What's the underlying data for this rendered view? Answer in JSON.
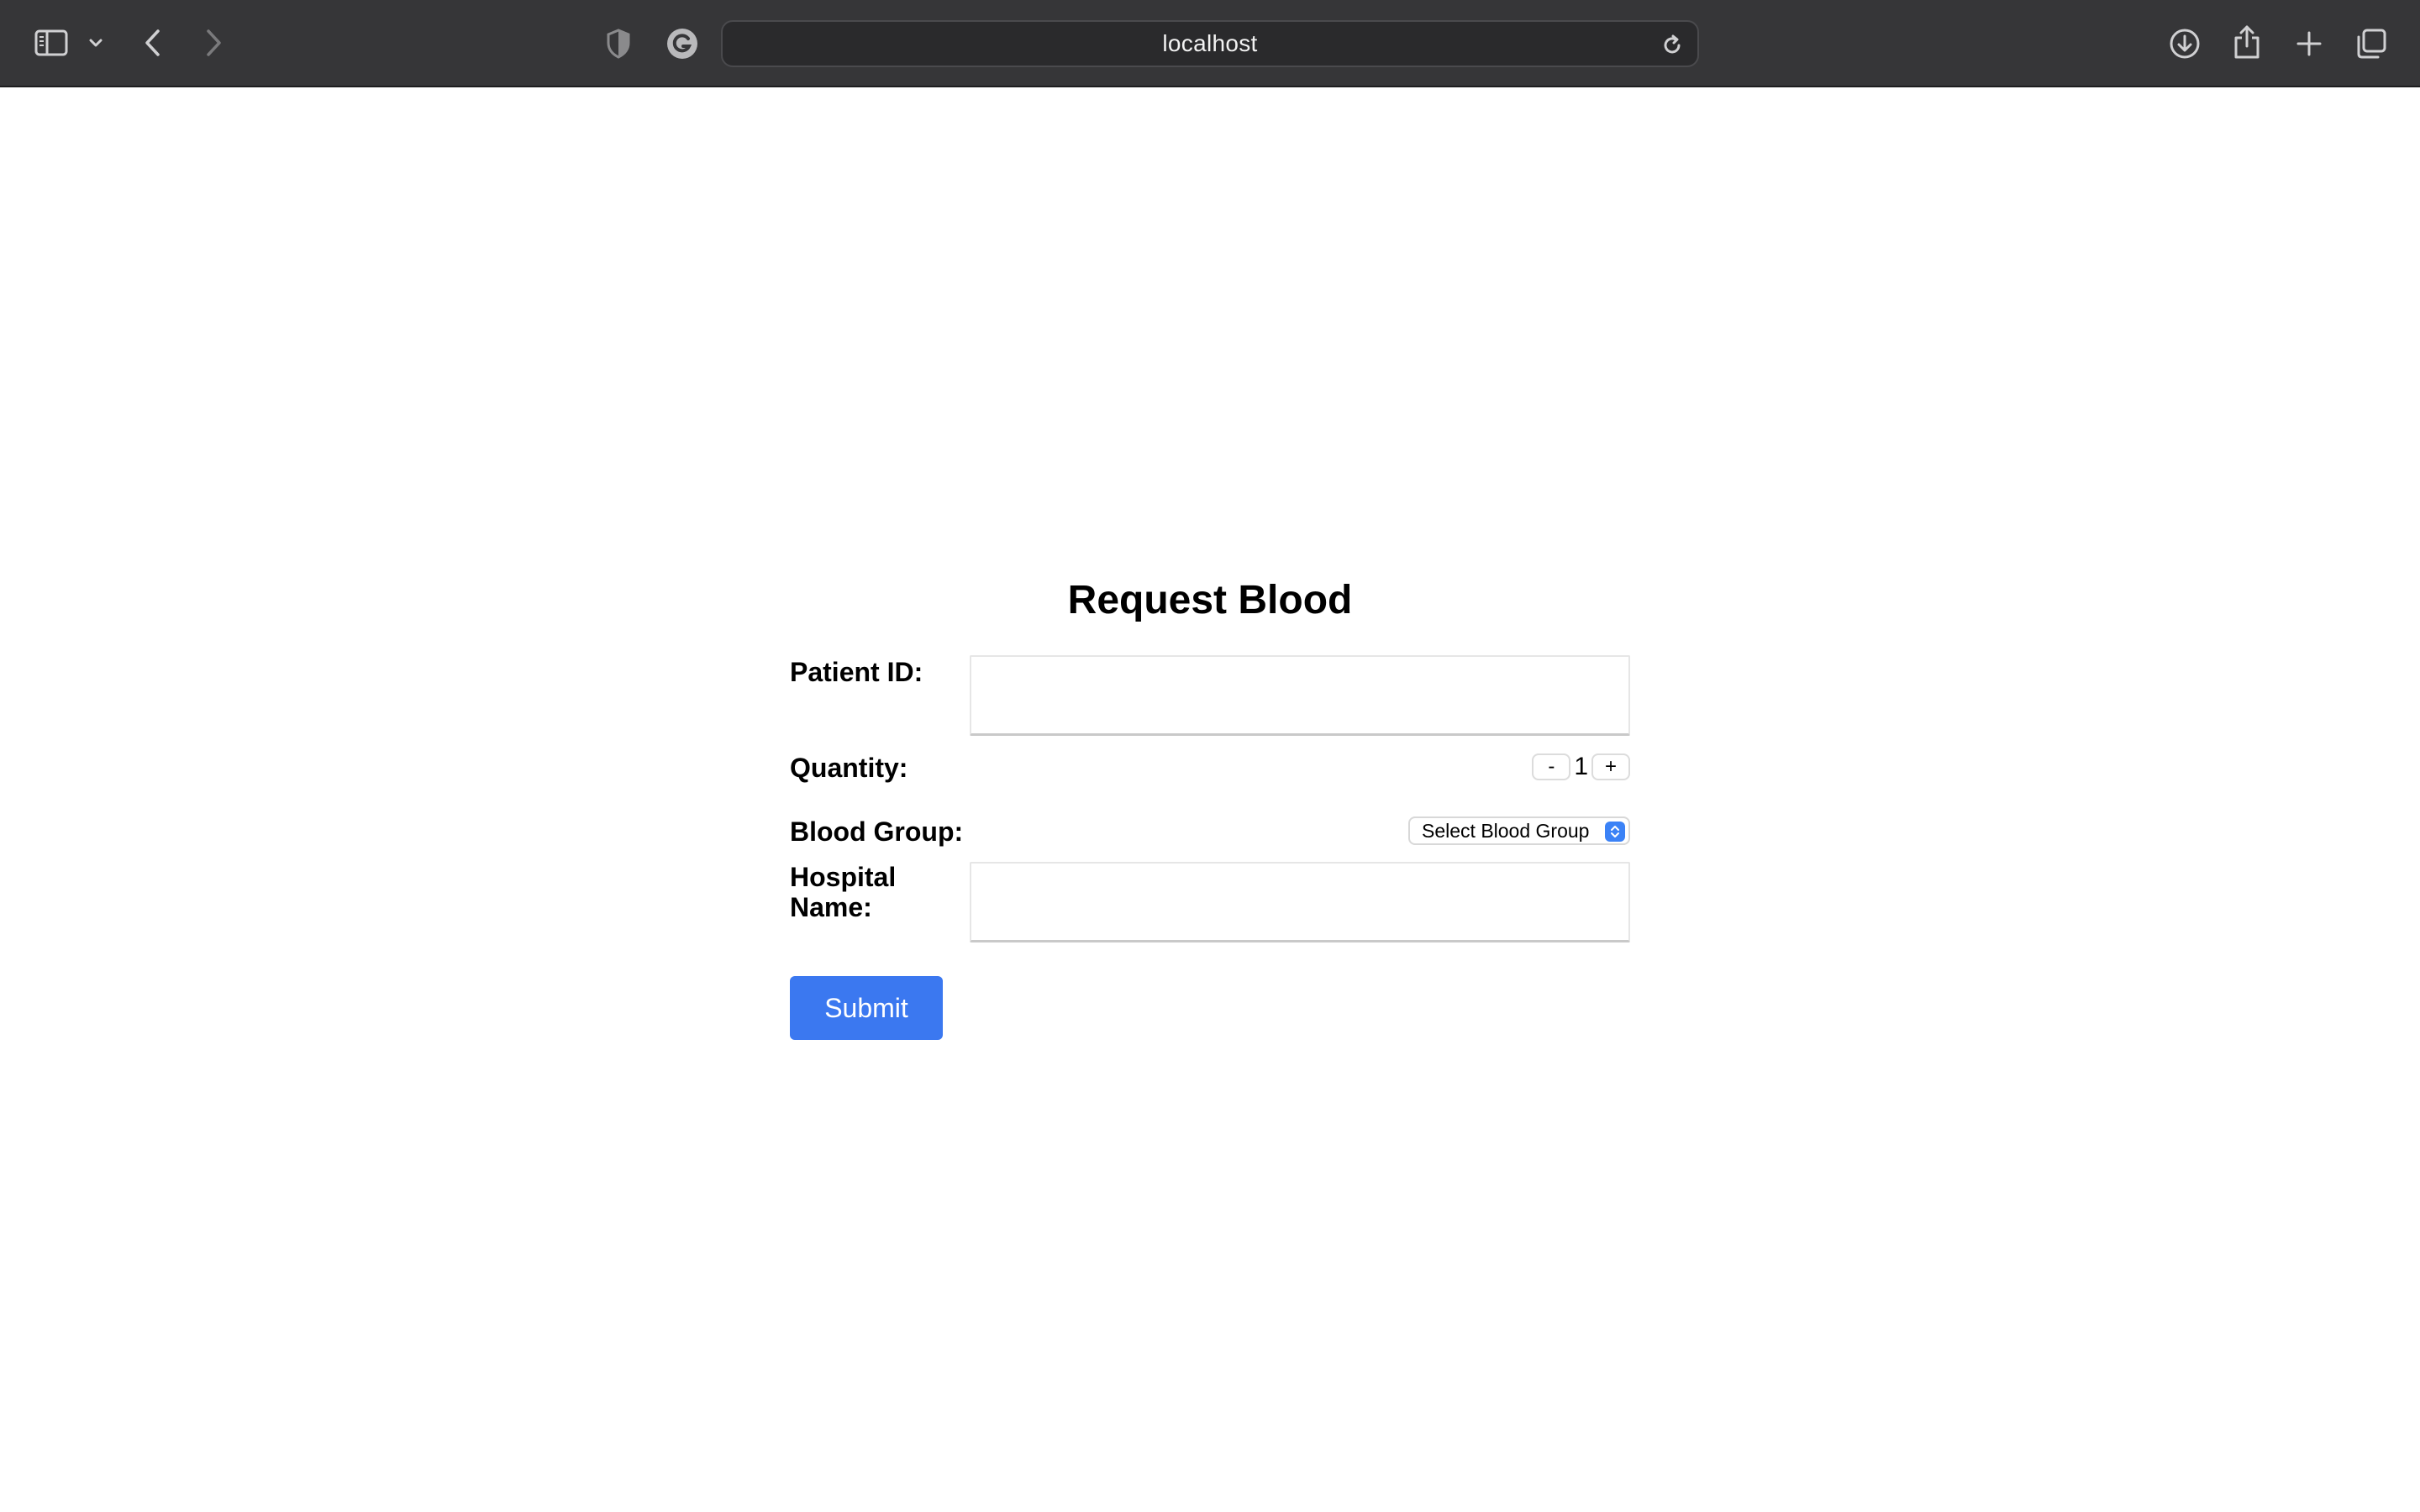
{
  "browser": {
    "address": "localhost",
    "icons": [
      "sidebar-icon",
      "chevron-down-icon",
      "back-icon",
      "forward-icon",
      "shield-icon",
      "grammarly-icon",
      "reload-icon",
      "download-icon",
      "share-icon",
      "new-tab-icon",
      "tabs-overview-icon"
    ]
  },
  "form": {
    "title": "Request Blood",
    "patient_id_label": "Patient ID:",
    "patient_id_value": "",
    "quantity_label": "Quantity:",
    "quantity_minus": "-",
    "quantity_value": "1",
    "quantity_plus": "+",
    "blood_group_label": "Blood Group:",
    "blood_group_selected": "Select Blood Group",
    "hospital_label_line1": "Hospital",
    "hospital_label_line2": "Name:",
    "hospital_value": "",
    "submit_label": "Submit"
  },
  "colors": {
    "toolbar_bg": "#363638",
    "submit_bg": "#3b78f0",
    "select_accent": "#3b82f6"
  }
}
